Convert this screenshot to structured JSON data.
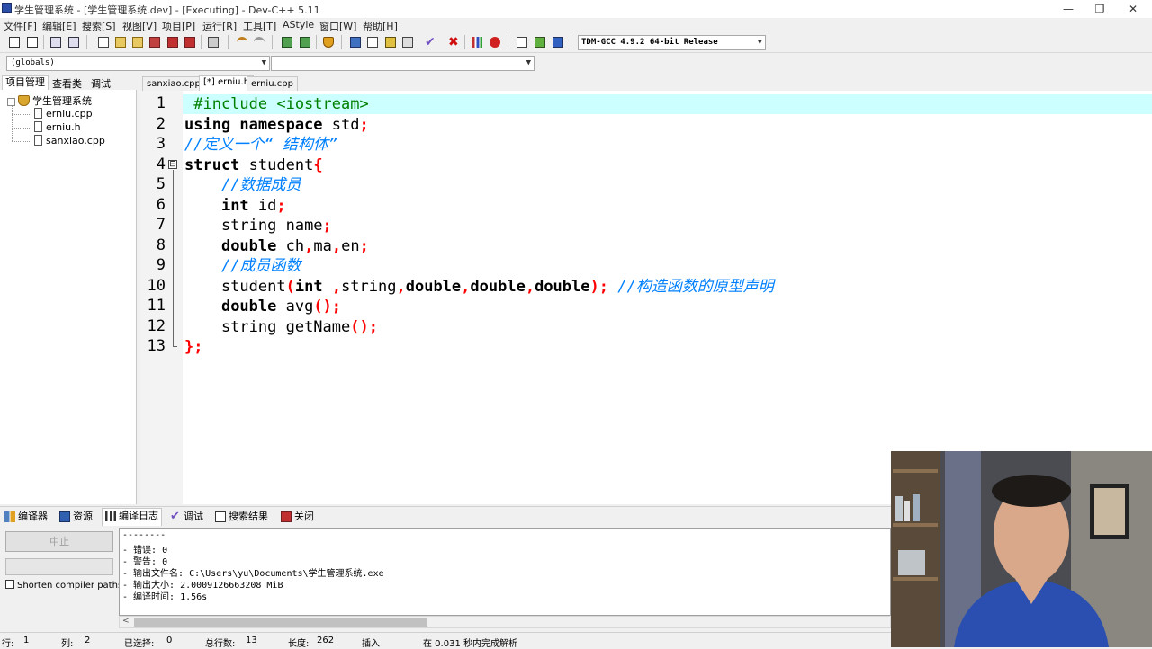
{
  "window": {
    "title": "学生管理系统 - [学生管理系统.dev] - [Executing] - Dev-C++ 5.11",
    "minimize": "—",
    "restore": "❐",
    "close": "✕"
  },
  "menu": [
    "文件[F]",
    "编辑[E]",
    "搜索[S]",
    "视图[V]",
    "项目[P]",
    "运行[R]",
    "工具[T]",
    "AStyle",
    "窗口[W]",
    "帮助[H]"
  ],
  "toolbar": {
    "compiler": "TDM-GCC 4.9.2 64-bit Release",
    "icons": [
      "new-project-icon",
      "open-project-icon",
      "class-browser-icon",
      "split-icon",
      "new-file-icon",
      "open-file-icon",
      "save-icon",
      "save-all-icon",
      "close-icon",
      "close-all-icon",
      "print-icon",
      "undo-icon",
      "redo-icon",
      "indent-icon",
      "unindent-icon",
      "bookmark-icon",
      "compile-icon",
      "run-icon",
      "compile-run-icon",
      "rebuild-icon",
      "syntax-check-icon",
      "stop-icon",
      "chart-icon",
      "debug-icon",
      "goto-icon",
      "insert-icon",
      "bookmark-toggle-icon"
    ]
  },
  "scope": {
    "globals": "(globals)",
    "members": ""
  },
  "left_panel": {
    "tabs": [
      "项目管理",
      "查看类",
      "调试"
    ],
    "project": "学生管理系统",
    "files": [
      "erniu.cpp",
      "erniu.h",
      "sanxiao.cpp"
    ]
  },
  "editor": {
    "tabs": [
      "sanxiao.cpp",
      "[*] erniu.h",
      "erniu.cpp"
    ],
    "line_numbers": [
      "1",
      "2",
      "3",
      "4",
      "5",
      "6",
      "7",
      "8",
      "9",
      "10",
      "11",
      "12",
      "13"
    ],
    "fold_open": "⊟",
    "lines": [
      [
        {
          "t": " #include <iostream>",
          "c": "pp"
        }
      ],
      [
        {
          "t": "using namespace ",
          "c": "kw"
        },
        {
          "t": "std",
          "c": ""
        },
        {
          "t": ";",
          "c": "sym"
        }
      ],
      [
        {
          "t": "//定义一个“ 结构体”",
          "c": "cm"
        }
      ],
      [
        {
          "t": "struct ",
          "c": "kw"
        },
        {
          "t": "student",
          "c": ""
        },
        {
          "t": "{",
          "c": "sym"
        }
      ],
      [
        {
          "t": "    ",
          "c": ""
        },
        {
          "t": "//数据成员",
          "c": "cm"
        }
      ],
      [
        {
          "t": "    ",
          "c": ""
        },
        {
          "t": "int ",
          "c": "kw"
        },
        {
          "t": "id",
          "c": ""
        },
        {
          "t": ";",
          "c": "sym"
        }
      ],
      [
        {
          "t": "    ",
          "c": ""
        },
        {
          "t": "string name",
          "c": ""
        },
        {
          "t": ";",
          "c": "sym"
        }
      ],
      [
        {
          "t": "    ",
          "c": ""
        },
        {
          "t": "double ",
          "c": "kw"
        },
        {
          "t": "ch",
          "c": ""
        },
        {
          "t": ",",
          "c": "sym"
        },
        {
          "t": "ma",
          "c": ""
        },
        {
          "t": ",",
          "c": "sym"
        },
        {
          "t": "en",
          "c": ""
        },
        {
          "t": ";",
          "c": "sym"
        }
      ],
      [
        {
          "t": "    ",
          "c": ""
        },
        {
          "t": "//成员函数",
          "c": "cm"
        }
      ],
      [
        {
          "t": "    ",
          "c": ""
        },
        {
          "t": "student",
          "c": ""
        },
        {
          "t": "(",
          "c": "sym"
        },
        {
          "t": "int ",
          "c": "kw"
        },
        {
          "t": ",",
          "c": "sym"
        },
        {
          "t": "string",
          "c": ""
        },
        {
          "t": ",",
          "c": "sym"
        },
        {
          "t": "double",
          "c": "kw"
        },
        {
          "t": ",",
          "c": "sym"
        },
        {
          "t": "double",
          "c": "kw"
        },
        {
          "t": ",",
          "c": "sym"
        },
        {
          "t": "double",
          "c": "kw"
        },
        {
          "t": "); ",
          "c": "sym"
        },
        {
          "t": "//构造函数的原型声明",
          "c": "cm"
        }
      ],
      [
        {
          "t": "    ",
          "c": ""
        },
        {
          "t": "double ",
          "c": "kw"
        },
        {
          "t": "avg",
          "c": ""
        },
        {
          "t": "();",
          "c": "sym"
        }
      ],
      [
        {
          "t": "    ",
          "c": ""
        },
        {
          "t": "string getName",
          "c": ""
        },
        {
          "t": "();",
          "c": "sym"
        }
      ],
      [
        {
          "t": "};",
          "c": "sym"
        }
      ]
    ]
  },
  "bottom": {
    "tabs": [
      "编译器",
      "资源",
      "编译日志",
      "调试",
      "搜索结果",
      "关闭"
    ],
    "abort": "中止",
    "shorten": "Shorten compiler paths",
    "log": [
      "--------",
      "- 错误: 0",
      "- 警告: 0",
      "- 输出文件名: C:\\Users\\yu\\Documents\\学生管理系统.exe",
      "- 输出大小: 2.0009126663208 MiB",
      "- 编译时间: 1.56s"
    ]
  },
  "status": {
    "row_label": "行:",
    "row": "1",
    "col_label": "列:",
    "col": "2",
    "sel_label": "已选择:",
    "sel": "0",
    "total_label": "总行数:",
    "total": "13",
    "len_label": "长度:",
    "len": "262",
    "mode": "插入",
    "parse": "在 0.031 秒内完成解析"
  }
}
